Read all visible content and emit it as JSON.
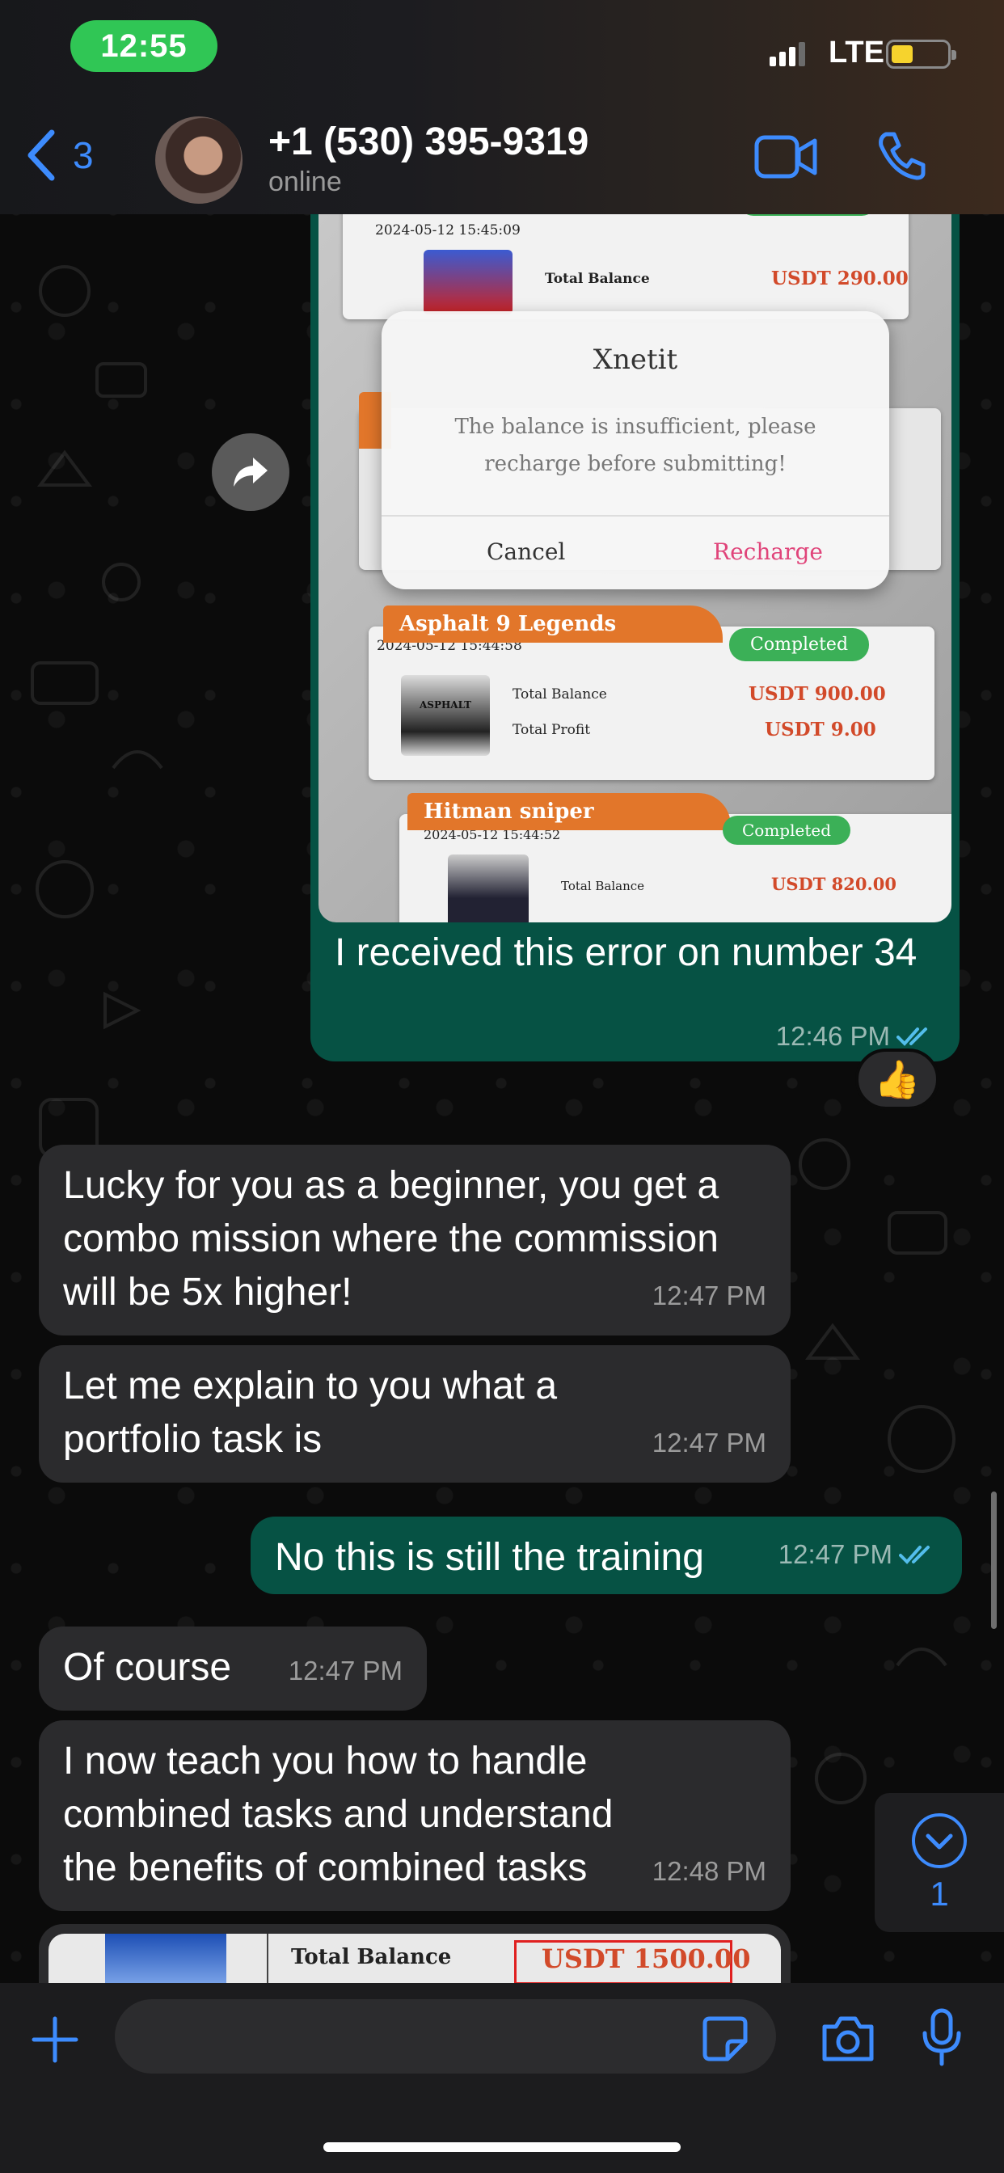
{
  "status_bar": {
    "time": "12:55",
    "network": "LTE",
    "battery_level": 0.25,
    "colors": {
      "time_pill": "#30c655",
      "battery_fill": "#f6d32d"
    }
  },
  "header": {
    "back_count": "3",
    "contact_name": "+1 (530) 395-9319",
    "contact_status": "online",
    "icons": [
      "chevron-left-icon",
      "video-call-icon",
      "phone-icon"
    ],
    "accent_color": "#3d8bfd"
  },
  "shared_image": {
    "cards": [
      {
        "date": "2024-05-12 15:45:09",
        "balance_label": "Total Balance",
        "balance_value": "USDT 290.00"
      },
      {
        "title": "Asphalt 9 Legends",
        "status": "Completed",
        "date": "2024-05-12 15:44:58",
        "logo_text": "ASPHALT",
        "balance_label": "Total Balance",
        "balance_value": "USDT 900.00",
        "profit_label": "Total Profit",
        "profit_value": "USDT 9.00"
      },
      {
        "title": "Hitman sniper",
        "status": "Completed",
        "date": "2024-05-12 15:44:52",
        "balance_label": "Total Balance",
        "balance_value": "USDT 820.00"
      }
    ],
    "dialog": {
      "title": "Xnetit",
      "message": "The balance is insufficient, please recharge before submitting!",
      "cancel": "Cancel",
      "confirm": "Recharge"
    }
  },
  "messages": [
    {
      "direction": "out",
      "text": "I received this error on number 34",
      "time": "12:46 PM",
      "reaction": "👍"
    },
    {
      "direction": "in",
      "text": "Lucky for you as a beginner, you get a combo mission where the commission will be 5x higher!",
      "time": "12:47 PM"
    },
    {
      "direction": "in",
      "text": "Let me explain to you what a portfolio task is",
      "time": "12:47 PM"
    },
    {
      "direction": "out",
      "text": "No this is still the training",
      "time": "12:47 PM"
    },
    {
      "direction": "in",
      "text": "Of course",
      "time": "12:47 PM"
    },
    {
      "direction": "in",
      "text": "I now teach you how to handle combined tasks and understand the benefits of combined tasks",
      "time": "12:48 PM"
    }
  ],
  "partial_image": {
    "balance_label": "Total Balance",
    "balance_value": "USDT 1500.00"
  },
  "scroll_down": {
    "unread_count": "1"
  },
  "input_bar": {
    "icons": [
      "plus-icon",
      "sticker-icon",
      "camera-icon",
      "microphone-icon"
    ]
  }
}
